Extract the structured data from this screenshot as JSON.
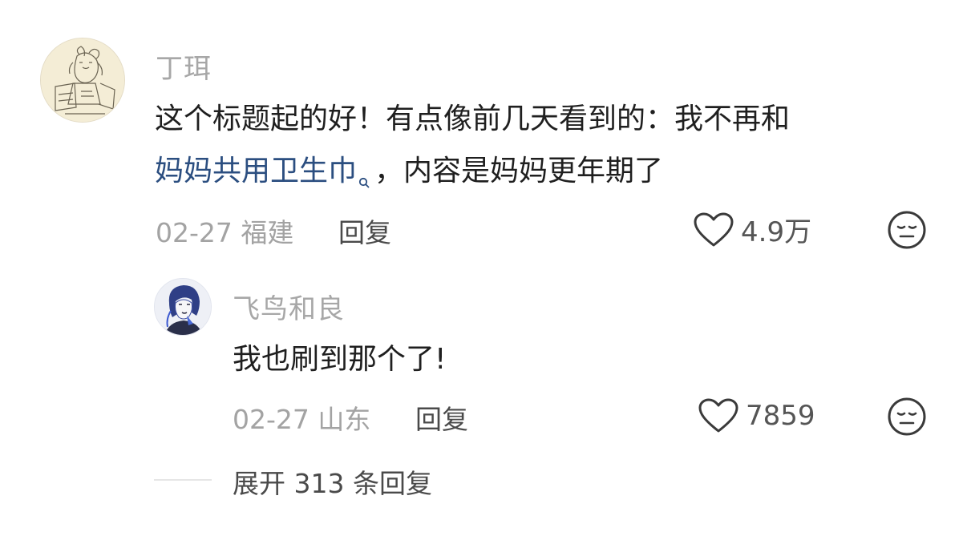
{
  "comment": {
    "username": "丁珥",
    "text_line1": "这个标题起的好！有点像前几天看到的：我不再和",
    "link_text": "妈妈共用卫生巾",
    "text_line2_rest": "，内容是妈妈更年期了",
    "date_location": "02-27 福建",
    "reply_label": "回复",
    "like_count": "4.9万"
  },
  "reply": {
    "username": "飞鸟和良",
    "text": "我也刷到那个了!",
    "date_location": "02-27 山东",
    "reply_label": "回复",
    "like_count": "7859"
  },
  "expand_replies_label": "展开 313 条回复",
  "icons": {
    "like": "heart-outline-icon",
    "emoji": "expressionless-face-icon",
    "search": "search-icon"
  },
  "colors": {
    "username": "#a7a7a7",
    "link": "#2b4e80",
    "text": "#1f1f1f",
    "meta": "#a3a3a3"
  }
}
